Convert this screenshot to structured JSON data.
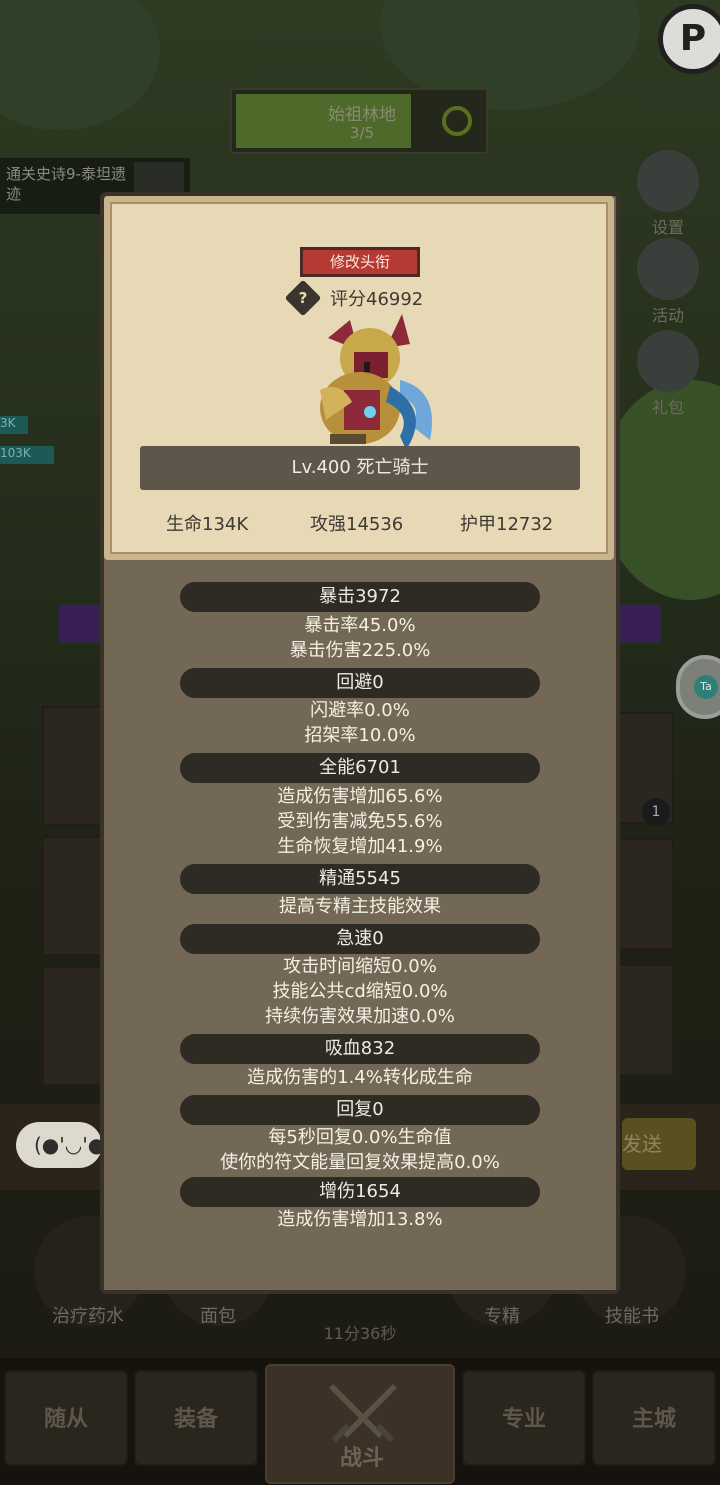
{
  "map": {
    "name": "始祖林地",
    "progress": "3/5"
  },
  "quest": {
    "text": "通关史诗9-泰坦遗迹"
  },
  "side_buttons": [
    "设置",
    "活动",
    "礼包"
  ],
  "left_bars": [
    "3K",
    "103K"
  ],
  "corner_logo": "P",
  "right_tab": "Ta",
  "chat": {
    "face": "(●'◡'●",
    "send": "发送"
  },
  "slot_badge": "1",
  "items": [
    "治疗药水",
    "面包",
    "专精",
    "技能书"
  ],
  "timer": "11分36秒",
  "nav": {
    "followers": "随从",
    "equipment": "装备",
    "battle": "战斗",
    "profession": "专业",
    "city": "主城"
  },
  "card": {
    "title_button": "修改头衔",
    "help": "?",
    "score": "评分46992",
    "level_name": "Lv.400 死亡骑士",
    "hp": "生命134K",
    "attack": "攻强14536",
    "armor": "护甲12732"
  },
  "stats": [
    {
      "name": "暴击3972",
      "lines": [
        "暴击率45.0%",
        "暴击伤害225.0%"
      ]
    },
    {
      "name": "回避0",
      "lines": [
        "闪避率0.0%",
        "招架率10.0%"
      ]
    },
    {
      "name": "全能6701",
      "lines": [
        "造成伤害增加65.6%",
        "受到伤害减免55.6%",
        "生命恢复增加41.9%"
      ]
    },
    {
      "name": "精通5545",
      "lines": [
        "提高专精主技能效果"
      ]
    },
    {
      "name": "急速0",
      "lines": [
        "攻击时间缩短0.0%",
        "技能公共cd缩短0.0%",
        "持续伤害效果加速0.0%"
      ]
    },
    {
      "name": "吸血832",
      "lines": [
        "造成伤害的1.4%转化成生命"
      ]
    },
    {
      "name": "回复0",
      "lines": [
        "每5秒回复0.0%生命值",
        "使你的符文能量回复效果提高0.0%"
      ]
    },
    {
      "name": "增伤1654",
      "lines": [
        "造成伤害增加13.8%"
      ]
    }
  ]
}
